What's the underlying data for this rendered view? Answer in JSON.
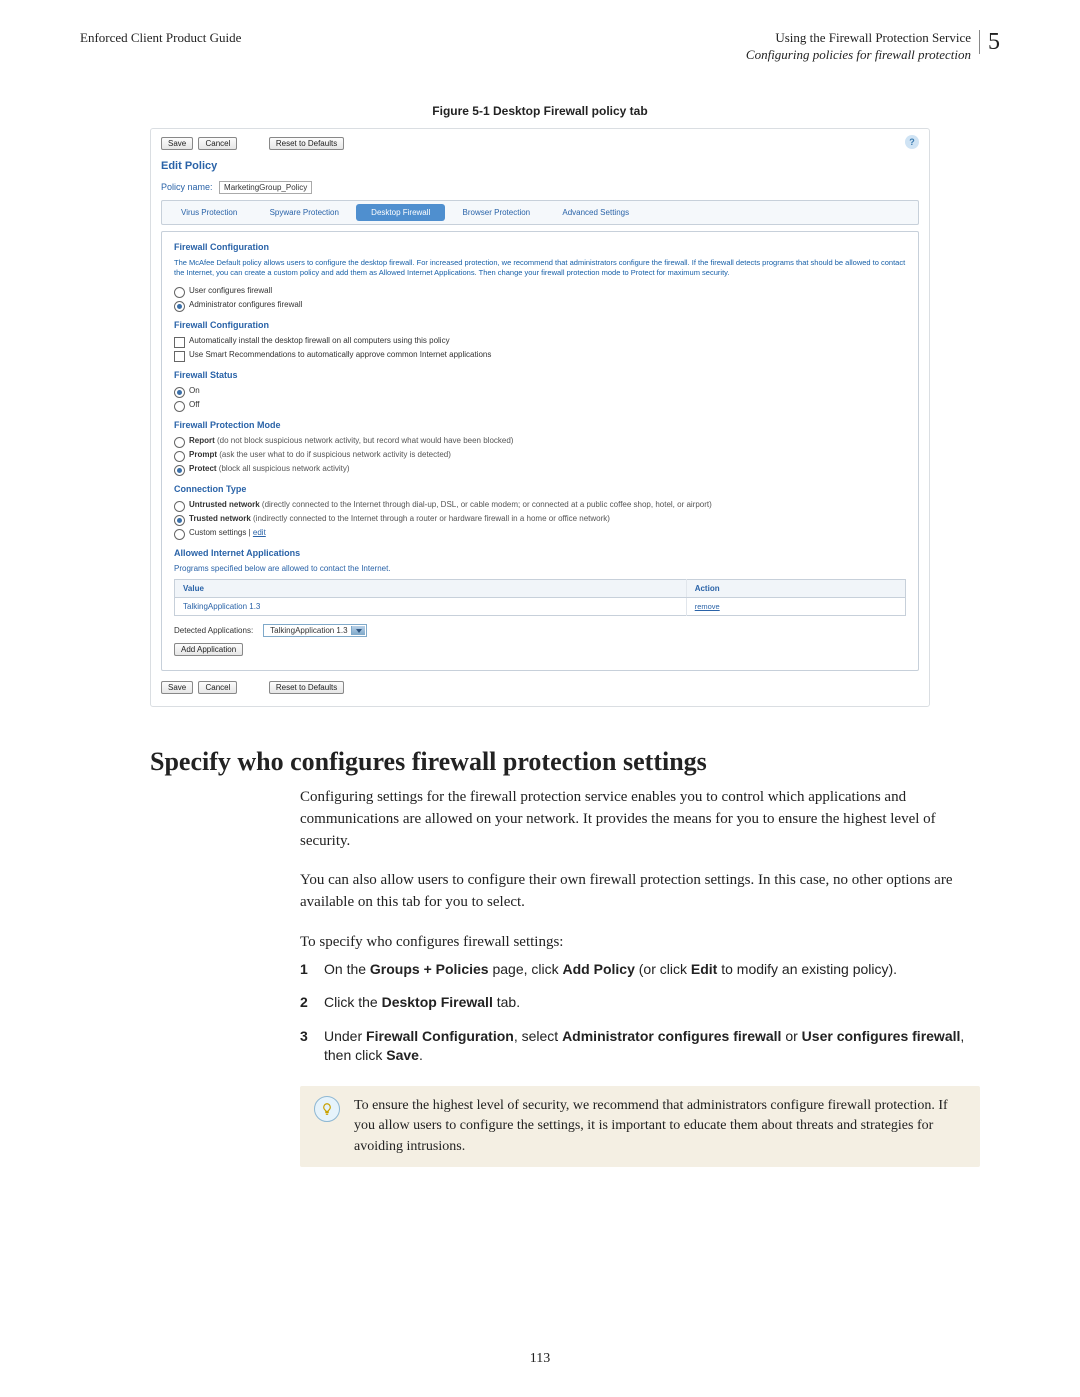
{
  "page": {
    "header_left": "Enforced Client Product Guide",
    "header_right_line1": "Using the Firewall Protection Service",
    "header_right_line2": "Configuring policies for firewall protection",
    "chapter_number": "5",
    "figure_caption": "Figure 5-1  Desktop Firewall policy tab",
    "foot_page_number": "113"
  },
  "panel": {
    "help_symbol": "?",
    "top_buttons": {
      "save": "Save",
      "cancel": "Cancel",
      "reset": "Reset to Defaults"
    },
    "edit_policy_title": "Edit Policy",
    "policy_name_label": "Policy name:",
    "policy_name_value": "MarketingGroup_Policy",
    "tabs": {
      "virus": "Virus Protection",
      "spyware": "Spyware Protection",
      "desktop_firewall": "Desktop Firewall",
      "browser": "Browser Protection",
      "advanced": "Advanced Settings"
    },
    "fc_title": "Firewall Configuration",
    "fc_info": "The McAfee Default policy allows users to configure the desktop firewall. For increased protection, we recommend that administrators configure the firewall. If the firewall detects programs that should be allowed to contact the Internet, you can create a custom policy and add them as Allowed Internet Applications. Then change your firewall protection mode to Protect for maximum security.",
    "who": {
      "user": "User configures firewall",
      "admin": "Administrator configures firewall"
    },
    "fc2_title": "Firewall Configuration",
    "fc2_check1": "Automatically install the desktop firewall on all computers using this policy",
    "fc2_check2": "Use Smart Recommendations to automatically approve common Internet applications",
    "status_title": "Firewall Status",
    "status": {
      "on": "On",
      "off": "Off"
    },
    "mode_title": "Firewall Protection Mode",
    "mode": {
      "report_name": "Report",
      "report_desc": "(do not block suspicious network activity, but record what would have been blocked)",
      "prompt_name": "Prompt",
      "prompt_desc": "(ask the user what to do if suspicious network activity is detected)",
      "protect_name": "Protect",
      "protect_desc": "(block all suspicious network activity)"
    },
    "conn_title": "Connection Type",
    "conn": {
      "untrusted_name": "Untrusted network",
      "untrusted_desc": "(directly connected to the Internet through dial-up, DSL, or cable modem; or connected at a public coffee shop, hotel, or airport)",
      "trusted_name": "Trusted network",
      "trusted_desc": "(indirectly connected to the Internet through a router or hardware firewall in a home or office network)",
      "custom_name": "Custom settings",
      "custom_edit": "edit"
    },
    "allowed_title": "Allowed Internet Applications",
    "allowed_note": "Programs specified below are allowed to contact the Internet.",
    "table": {
      "h_value": "Value",
      "h_action": "Action",
      "row_value": "TalkingApplication 1.3",
      "row_action": "remove"
    },
    "detected_label": "Detected Applications:",
    "detected_select": "TalkingApplication 1.3",
    "add_app_btn": "Add Application",
    "bottom_buttons": {
      "save": "Save",
      "cancel": "Cancel",
      "reset": "Reset to Defaults"
    }
  },
  "body": {
    "h2": "Specify who configures firewall protection settings",
    "p1": "Configuring settings for the firewall protection service enables you to control which applications and communications are allowed on your network. It provides the means for you to ensure the highest level of security.",
    "p2": "You can also allow users to configure their own firewall protection settings. In this case, no other options are available on this tab for you to select.",
    "steps_intro": "To specify who configures firewall settings:",
    "step1_pre": "On the ",
    "step1_b1": "Groups + Policies",
    "step1_mid1": " page, click ",
    "step1_b2": "Add Policy",
    "step1_mid2": " (or click ",
    "step1_b3": "Edit",
    "step1_post": " to modify an existing policy).",
    "step2_pre": "Click the ",
    "step2_b1": "Desktop Firewall",
    "step2_post": " tab.",
    "step3_pre": "Under ",
    "step3_b1": "Firewall Configuration",
    "step3_mid1": ", select ",
    "step3_b2": "Administrator configures firewall",
    "step3_mid2": " or ",
    "step3_b3": "User configures firewall",
    "step3_mid3": ", then click ",
    "step3_b4": "Save",
    "step3_post": ".",
    "note": "To ensure the highest level of security, we recommend that administrators configure firewall protection. If you allow users to configure the settings, it is important to educate them about threats and strategies for avoiding intrusions."
  }
}
